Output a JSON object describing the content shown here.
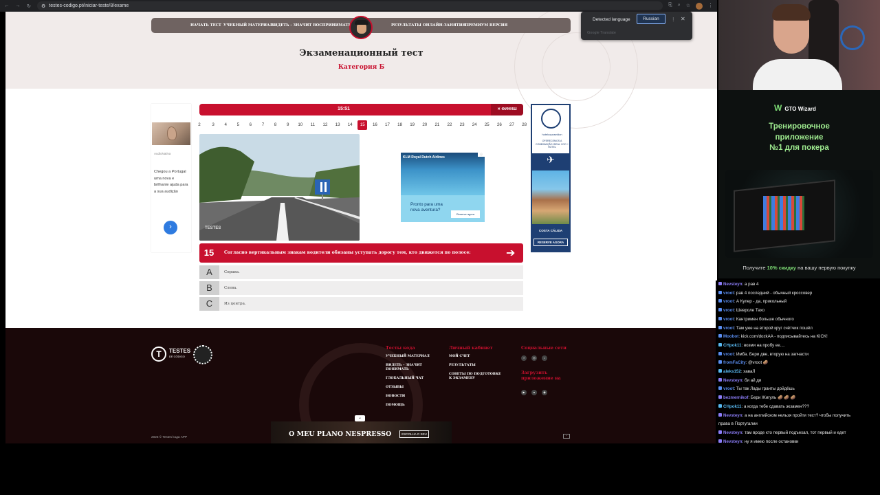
{
  "browser": {
    "url": "testes-codigo.pt/iniciar-teste/8/exame"
  },
  "nav": {
    "items": [
      "НАЧАТЬ ТЕСТ",
      "УЧЕБНЫЙ МАТЕРИАЛ",
      "ВИДЕТЬ - ЗНАЧИТ ВОСПРИНИМАТЬ",
      "РЕЗУЛЬТАТЫ",
      "ОНЛАЙН-ЗАНЯТИЯ",
      "ПРЕМИУМ ВЕРСИЯ"
    ]
  },
  "page": {
    "title": "Экзаменационный тест",
    "category": "Категория Б"
  },
  "translate": {
    "detected": "Detected language",
    "language": "Russian",
    "provider": "Google Translate"
  },
  "left_ad": {
    "brand": "AudioNativa",
    "text": "Chegou a Portugal uma nova e brilhante ajuda para a sua audição"
  },
  "timer": {
    "time": "15:51",
    "finish": "ФИНИШ"
  },
  "question_numbers": {
    "items": [
      "2",
      "3",
      "4",
      "5",
      "6",
      "7",
      "8",
      "9",
      "10",
      "11",
      "12",
      "13",
      "14",
      "15",
      "16",
      "17",
      "18",
      "19",
      "20",
      "21",
      "22",
      "23",
      "24",
      "25",
      "26",
      "27",
      "28"
    ],
    "active": "15"
  },
  "question": {
    "image_watermark": "TESTES",
    "number": "15",
    "text": "Согласно вертикальным знакам водители обязаны уступать дорогу тем, кто движется по полосе:",
    "answers": [
      {
        "letter": "A",
        "text": "Справа."
      },
      {
        "letter": "B",
        "text": "Слева."
      },
      {
        "letter": "C",
        "text": "Из центра."
      }
    ]
  },
  "center_ad": {
    "brand": "KLM Royal Dutch Airlines",
    "tagline": "Pronto para uma nova aventura?",
    "cta": "Reserve agora"
  },
  "right_ad": {
    "hotel": "hotelcoposeidon",
    "promo": "OFERECEMOS A COMBINAÇÃO IDEAL VOO + HOTEL",
    "location": "COSTA CÁLIDA",
    "cta": "RESERVE AGORA"
  },
  "footer": {
    "logo_main": "TESTES",
    "logo_sub": "DE CÓDIGO",
    "col1_title": "Тесты кода",
    "col1_links": [
      "УЧЕБНЫЙ МАТЕРИАЛ",
      "ВИДЕТЬ – ЗНАЧИТ ПОНИМАТЬ",
      "ГЛОБАЛЬНЫЙ ЧАТ",
      "ОТЗЫВЫ",
      "НОВОСТИ",
      "ПОМОЩЬ"
    ],
    "col2_title": "Личный кабинет",
    "col2_links": [
      "МОЙ СЧЕТ",
      "РЕЗУЛЬТАТЫ",
      "СОВЕТЫ ПО ПОДГОТОВКЕ К ЭКЗАМЕНУ"
    ],
    "col3_title": "Социальные сети",
    "col3_download": "Загрузить приложение на",
    "copyright": "2025 © Testes kода APP"
  },
  "nespresso_ad": {
    "text": "O MEU PLANO NESPRESSO",
    "cta": "ESCOLHA O SEU"
  },
  "gto_ad": {
    "brand": "GTO Wizard",
    "headline_1": "Тренировочное",
    "headline_2": "приложение",
    "headline_3": "№1 для покера",
    "promo_prefix": "Получите",
    "promo_bold": "10% скидку",
    "promo_suffix": "на вашу первую покупку"
  },
  "chat": {
    "messages": [
      {
        "user": "Nevsteyn",
        "text": "а рав 4",
        "color": "#8b7cf6"
      },
      {
        "user": "vroot",
        "text": "рав 4 последний - обычный кроссовер",
        "color": "#5a8df0"
      },
      {
        "user": "vroot",
        "text": "А Купер - да, прикольный",
        "color": "#5a8df0"
      },
      {
        "user": "vroot",
        "text": "Шевроле Тахо",
        "color": "#5a8df0"
      },
      {
        "user": "vroot",
        "text": "Кантримен больше обычного",
        "color": "#5a8df0"
      },
      {
        "user": "vroot",
        "text": "Там уже на второй круг счётчик пошёл",
        "color": "#5a8df0"
      },
      {
        "user": "Moobot",
        "text": "kick.com/dozkAA - подписывайтесь на KICK!",
        "color": "#5a8df0"
      },
      {
        "user": "CHpok11",
        "text": "возми на пробу ее....",
        "color": "#58b8f0"
      },
      {
        "user": "vroot",
        "text": "Имба. Бери две, вторую на запчасти",
        "color": "#5a8df0"
      },
      {
        "user": "fromFaCity",
        "text": "@vroot 🥔",
        "color": "#5a8df0"
      },
      {
        "user": "aleks152",
        "text": "хаваЛ",
        "color": "#58b8f0"
      },
      {
        "user": "Nevsteyn",
        "text": "би ай ди",
        "color": "#8b7cf6"
      },
      {
        "user": "vroot",
        "text": "Ты так Лады гранты дойдёшь",
        "color": "#5a8df0"
      },
      {
        "user": "bezmernikof",
        "text": "Бери Жигуль 🥔 🥔 🥔",
        "color": "#8b7cf6"
      },
      {
        "user": "CHpok11",
        "text": "а когда тебе сдавать экзамен???",
        "color": "#58b8f0"
      },
      {
        "user": "Nevsteyn",
        "text": "а на английском нельзя пройти тест? чтобы получить",
        "color": "#8b7cf6"
      },
      {
        "user": "",
        "text": "права в Португалии",
        "color": "#8b7cf6"
      },
      {
        "user": "Nevsteyn",
        "text": "там вроде кто первый подъехал, тот первый и едет",
        "color": "#8b7cf6"
      },
      {
        "user": "Nevsteyn",
        "text": "ну я имею после остановки",
        "color": "#8b7cf6"
      }
    ]
  },
  "colors": {
    "brand_red": "#c8102e",
    "gto_green": "#7ddc75"
  }
}
